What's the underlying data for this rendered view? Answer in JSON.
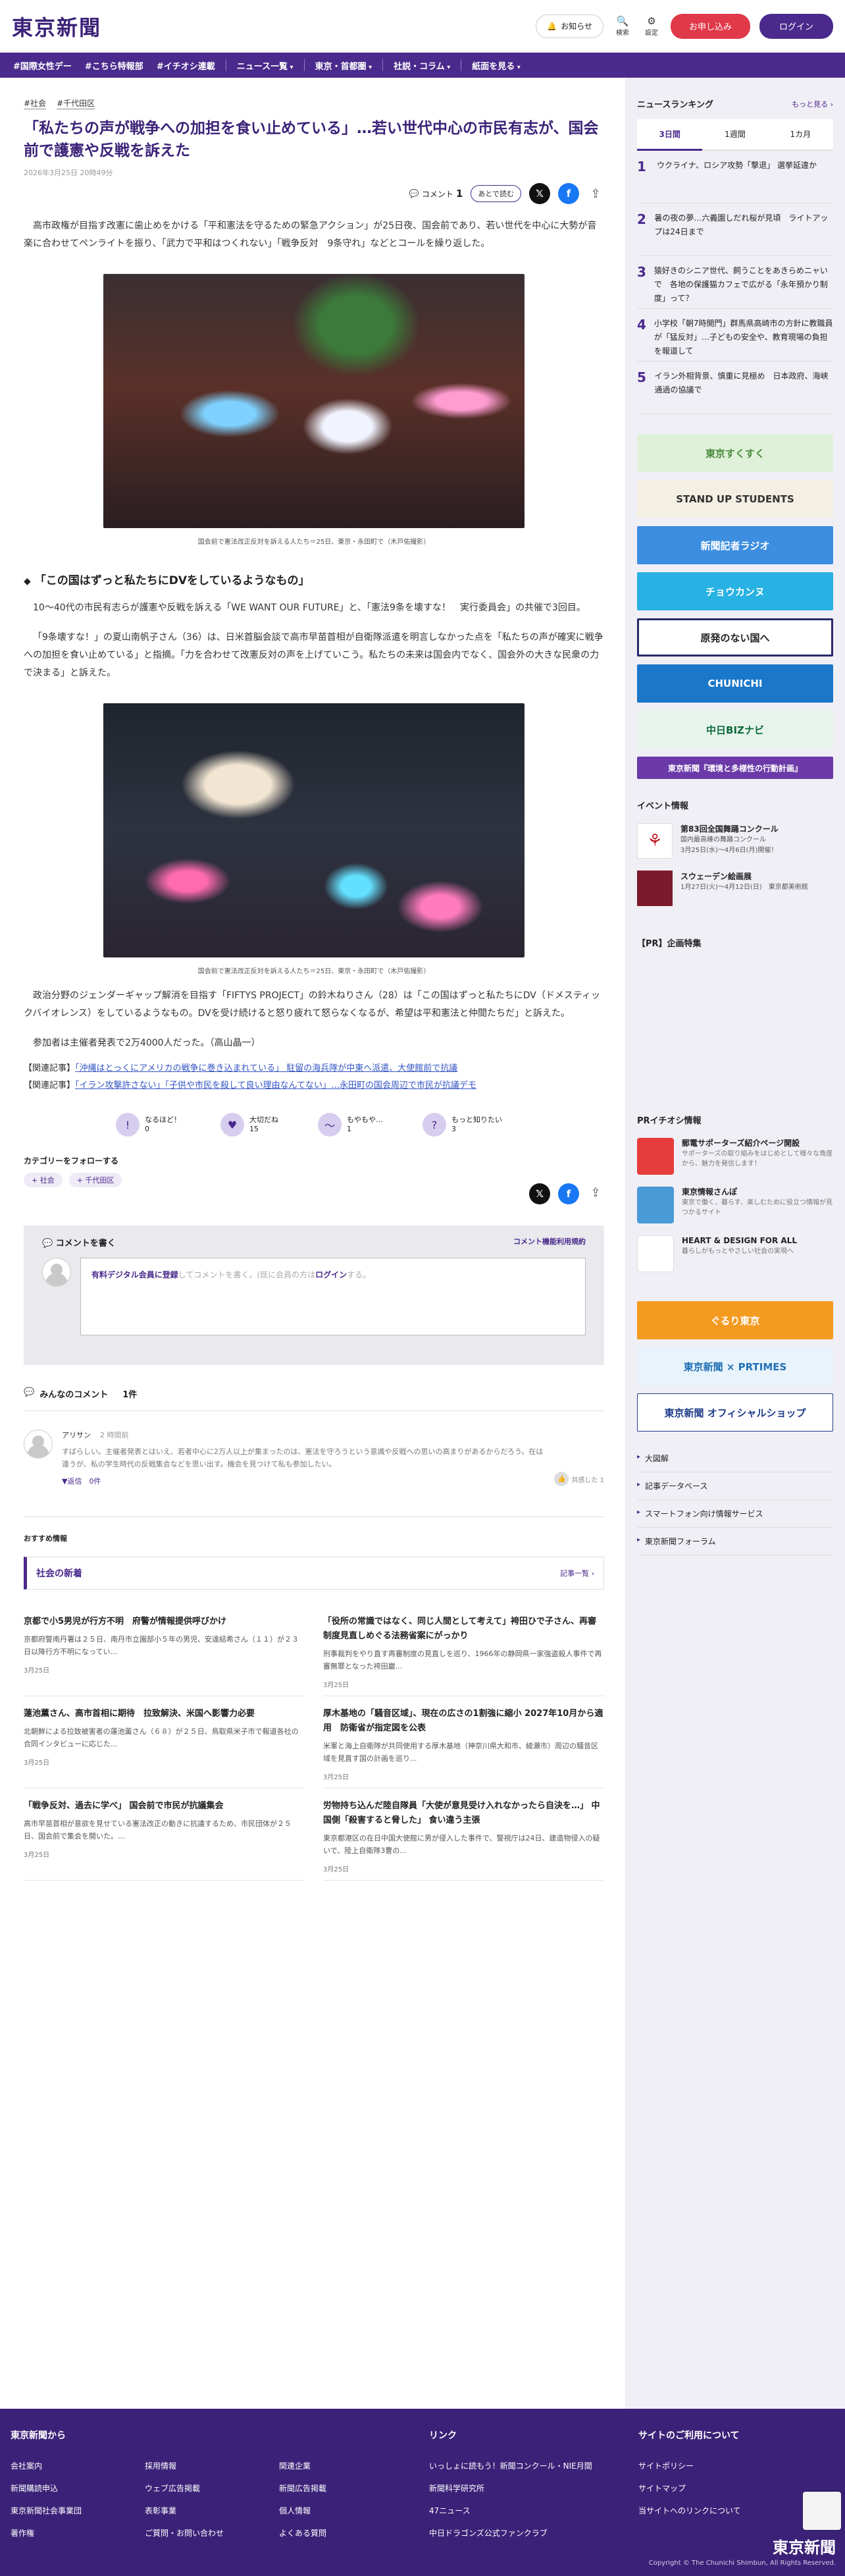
{
  "header": {
    "logo": "東京新聞",
    "notice": "お知らせ",
    "search": "検索",
    "settings": "設定",
    "signup": "お申し込み",
    "login": "ログイン"
  },
  "nav": [
    "#国際女性デー",
    "#こちら特報部",
    "#イチオシ連載",
    "ニュース一覧",
    "東京・首都圏",
    "社説・コラム",
    "紙面を見る"
  ],
  "article": {
    "tags": [
      "#社会",
      "#千代田区"
    ],
    "title": "「私たちの声が戦争への加担を食い止めている」…若い世代中心の市民有志が、国会前で護憲や反戦を訴えた",
    "date": "2026年3月25日 20時49分",
    "comment_label": "コメント",
    "comment_count": "1",
    "later": "あとで読む",
    "p1": "高市政権が目指す改憲に歯止めをかける「平和憲法を守るための緊急アクション」が25日夜、国会前であり、若い世代を中心に大勢が音楽に合わせてペンライトを振り、「武力で平和はつくれない」「戦争反対　9条守れ」などとコールを繰り返した。",
    "caption1": "国会前で憲法改正反対を訴える人たち＝25日、東京・永田町で（木戸佑撮影）",
    "subhead": "「この国はずっと私たちにDVをしているようなもの」",
    "p2": "10～40代の市民有志らが護憲や反戦を訴える「WE WANT OUR FUTURE」と、「憲法9条を壊すな！　実行委員会」の共催で3回目。",
    "p3": "「9条壊すな！」の夏山南帆子さん（36）は、日米首脳会談で高市早苗首相が自衛隊派遣を明言しなかった点を「私たちの声が確実に戦争への加担を食い止めている」と指摘。「力を合わせて改憲反対の声を上げていこう。私たちの未来は国会内でなく、国会外の大きな民衆の力で決まる」と訴えた。",
    "caption2": "国会前で憲法改正反対を訴える人たち＝25日、東京・永田町で（木戸佑撮影）",
    "p4": "政治分野のジェンダーギャップ解消を目指す「FIFTYS PROJECT」の鈴木ねりさん（28）は「この国はずっと私たちにDV（ドメスティックバイオレンス）をしているようなもの。DVを受け続けると怒り疲れて怒らなくなるが、希望は平和憲法と仲間たちだ」と訴えた。",
    "p5": "参加者は主催者発表で2万4000人だった。（高山晶一）",
    "related_label": "【関連記事】",
    "related1": "「沖縄はとっくにアメリカの戦争に巻き込まれている」 駐留の海兵隊が中東へ派遣、大使館前で抗議",
    "related2": "「イラン攻撃許さない」「子供や市民を殺して良い理由なんてない」…永田町の国会周辺で市民が抗議デモ"
  },
  "reactions": [
    {
      "label": "なるほど！",
      "count": "0",
      "icon": "!"
    },
    {
      "label": "大切だね",
      "count": "15",
      "icon": "♥"
    },
    {
      "label": "もやもや…",
      "count": "1",
      "icon": "～"
    },
    {
      "label": "もっと知りたい",
      "count": "3",
      "icon": "?"
    }
  ],
  "follow": {
    "label": "カテゴリーをフォローする",
    "tags": [
      "+ 社会",
      "+ 千代田区"
    ]
  },
  "comment_box": {
    "title": "コメントを書く",
    "policy": "コメント機能利用規約",
    "prompt_pre": "有料デジタル会員に登録",
    "prompt_mid": "してコメントを書く。(既に会員の方は",
    "prompt_login": "ログイン",
    "prompt_post": "する。"
  },
  "comments": {
    "heading": "みんなのコメント",
    "count": "1件",
    "items": [
      {
        "name": "アリサン",
        "time": "2 時間前",
        "text": "すばらしい。主催者発表とはいえ、若者中心に2万人以上が集まったのは、憲法を守ろうという意識や反戦への思いの高まりがあるからだろう。在は違うが、私の学生時代の反戦集会などを思い出す。機会を見つけて私も参加したい。",
        "reply": "▼返信　0件",
        "agree": "共感した 1"
      }
    ]
  },
  "recommend": "おすすめ情報",
  "news": {
    "heading": "社会の新着",
    "list_link": "記事一覧 ›",
    "items": [
      {
        "title": "京都で小5男児が行方不明　府警が情報提供呼びかけ",
        "body": "京都府警南丹署は２５日、南丹市立園部小５年の男児、安達結希さん（１１）が２３日以降行方不明になってい...",
        "date": "3月25日"
      },
      {
        "title": "「役所の常識ではなく、同じ人間として考えて」袴田ひで子さん、再審制度見直しめぐる法務省案にがっかり",
        "body": "刑事裁判をやり直す再審制度の見直しを巡り、1966年の静岡県一家強盗殺人事件で再審無罪となった袴田巖...",
        "date": "3月25日"
      },
      {
        "title": "蓮池薫さん、高市首相に期待　拉致解決、米国へ影響力必要",
        "body": "北朝鮮による拉致被害者の蓮池薫さん（６８）が２５日、鳥取県米子市で報道各社の合同インタビューに応じた...",
        "date": "3月25日"
      },
      {
        "title": "厚木基地の「騒音区域」、現在の広さの1割強に縮小 2027年10月から適用　防衛省が指定図を公表",
        "body": "米軍と海上自衛隊が共同使用する厚木基地（神奈川県大和市、綾瀬市）周辺の騒音区域を見直す国の計画を巡り...",
        "date": "3月25日"
      },
      {
        "title": "「戦争反対、過去に学べ」 国会前で市民が抗議集会",
        "body": "高市早苗首相が意欲を見せている憲法改正の動きに抗議するため、市民団体が２５日、国会前で集会を開いた。...",
        "date": "3月25日"
      },
      {
        "title": "労物持ち込んだ陸自隊員「大使が意見受け入れなかったら自決を…」 中国側「殺害すると脅した」 食い違う主張",
        "body": "東京都港区の在日中国大使館に男が侵入した事件で、警視庁は24日、建造物侵入の疑いで、陸上自衛隊3曹の...",
        "date": "3月25日"
      }
    ]
  },
  "ranking": {
    "heading": "ニュースランキング",
    "more": "もっと見る ›",
    "tabs": [
      "3日間",
      "1週間",
      "1カ月"
    ],
    "items": [
      "ウクライナ、ロシア攻勢「撃退」 選挙延違か",
      "暑の夜の夢…六義園しだれ桜が見頃　ライトアップは24日まで",
      "猿好きのシニア世代、飼うことをあきらめニャいで　各地の保護猫カフェで広がる「永年預かり制度」って？",
      "小学校「朝7時開門」群馬県高崎市の方針に教職員が「猛反対」…子どもの安全や、教育現場の負担を報道して",
      "イラン外相背景、慎重に見極め　日本政府、海峡通過の協議で"
    ]
  },
  "banners": [
    {
      "text": "東京すくすく",
      "bg": "#dff1d9",
      "fg": "#4a8a3c"
    },
    {
      "text": "STAND UP STUDENTS",
      "bg": "#f4efe3",
      "fg": "#333"
    },
    {
      "text": "新聞記者ラジオ",
      "bg": "#3d8ee0",
      "fg": "#fff"
    },
    {
      "text": "チョウカンヌ",
      "bg": "#27b2e3",
      "fg": "#fff"
    },
    {
      "text": "原発のない国へ",
      "bg": "#ffffff",
      "fg": "#222"
    },
    {
      "text": "CHUNICHI",
      "bg": "#1a77c9",
      "fg": "#fff"
    },
    {
      "text": "中日BIZナビ",
      "bg": "#e7f4ec",
      "fg": "#0e6a3a"
    },
    {
      "text": "東京新聞『環境と多様性の行動計画』",
      "bg": "#6b3aa8",
      "fg": "#fff"
    }
  ],
  "events": {
    "heading": "イベント情報",
    "items": [
      {
        "title": "第83回全国舞踊コンクール",
        "sub": "国内最高峰の舞踊コンクール",
        "date": "3月25日(水)～4月6日(月)開催！"
      },
      {
        "title": "スウェーデン絵画展",
        "sub": "1月27日(火)～4月12日(日)　東京都美術館",
        "date": ""
      }
    ]
  },
  "pr_heading": "【PR】企画特集",
  "pr_ichioshi": {
    "heading": "PRイチオシ情報",
    "items": [
      {
        "title": "郵電サポーターズ紹介ページ開設",
        "sub": "サポーターズの取り組みをはじめとして様々な角度から、魅力を発信します！"
      },
      {
        "title": "東京情報さんぽ",
        "sub": "東京で働く、暮らす、楽しむために役立つ情報が見つかるサイト"
      },
      {
        "title": "HEART & DESIGN FOR ALL",
        "sub": "暮らしがもっとやさしい社会の実現へ"
      }
    ]
  },
  "side_banners2": [
    {
      "text": "ぐるり東京",
      "bg": "#f39a1f",
      "fg": "#fff"
    },
    {
      "text": "東京新聞 × PRTIMES",
      "bg": "#e8f3fb",
      "fg": "#1f6fb5"
    },
    {
      "text": "東京新聞 オフィシャルショップ",
      "bg": "#ffffff",
      "fg": "#1f3d8a"
    }
  ],
  "side_links": [
    "大図解",
    "記事データベース",
    "スマートフォン向け情報サービス",
    "東京新聞フォーラム"
  ],
  "footer": {
    "from": "東京新聞から",
    "col1": [
      "会社案内",
      "新聞購読申込",
      "東京新聞社会事業団",
      "著作権"
    ],
    "col2": [
      "採用情報",
      "ウェブ広告掲載",
      "表彰事業",
      "ご質問・お問い合わせ"
    ],
    "col3": [
      "関連企業",
      "新聞広告掲載",
      "個人情報",
      "よくある質問"
    ],
    "link_h": "リンク",
    "links": [
      "いっしょに読もう！新聞コンクール・NIE月間",
      "新聞科学研究所",
      "47ニュース",
      "中日ドラゴンズ公式ファンクラブ"
    ],
    "site_h": "サイトのご利用について",
    "site": [
      "サイトポリシー",
      "サイトマップ",
      "当サイトへのリンクについて"
    ],
    "logo": "東京新聞",
    "copyright": "Copyright © The Chunichi Shimbun, All Rights Reserved."
  }
}
